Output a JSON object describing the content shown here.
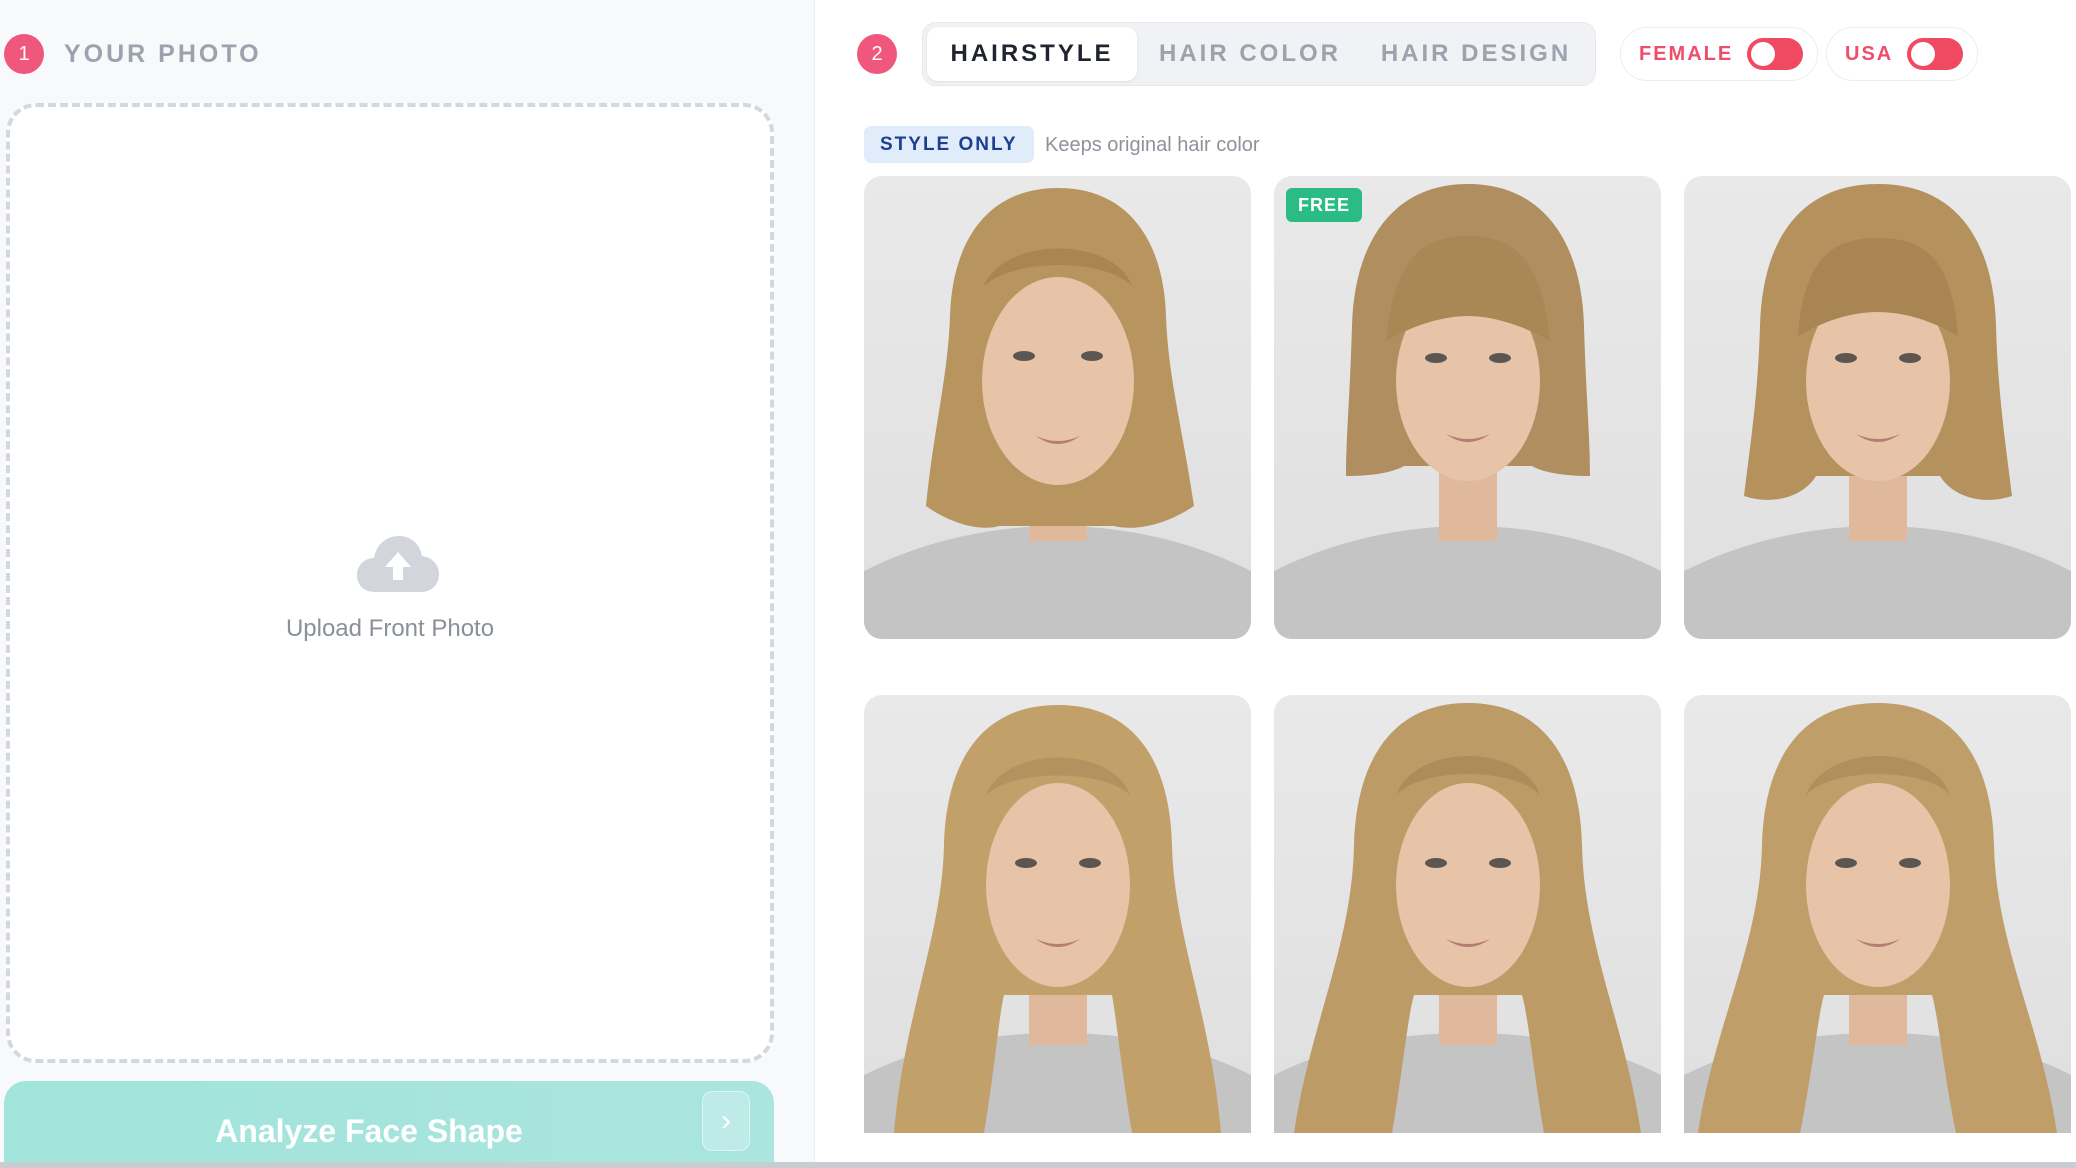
{
  "left": {
    "step": "1",
    "title": "YOUR PHOTO",
    "upload_label": "Upload Front Photo",
    "analyze_label": "Analyze Face Shape",
    "analyze_chevron": "›"
  },
  "right": {
    "step": "2",
    "tabs": [
      {
        "label": "HAIRSTYLE",
        "active": true
      },
      {
        "label": "HAIR COLOR",
        "active": false
      },
      {
        "label": "HAIR DESIGN",
        "active": false
      }
    ],
    "toggles": [
      {
        "label": "FEMALE",
        "on": true
      },
      {
        "label": "USA",
        "on": true
      }
    ],
    "style_badge": "STYLE ONLY",
    "style_note": "Keeps original hair color",
    "styles": [
      {
        "badge": "",
        "hair_length": "medium"
      },
      {
        "badge": "FREE",
        "hair_length": "bob-bangs"
      },
      {
        "badge": "",
        "hair_length": "bob-bangs"
      },
      {
        "badge": "",
        "hair_length": "long"
      },
      {
        "badge": "",
        "hair_length": "long"
      },
      {
        "badge": "",
        "hair_length": "long"
      }
    ]
  },
  "colors": {
    "accent": "#f0577d",
    "toggle_on": "#f04a62",
    "analyze_button": "#a0e4db",
    "free_badge": "#2bbb84",
    "hair": "#b8945f",
    "skin": "#e7c3a8",
    "shirt": "#c4c4c4"
  },
  "icons": {
    "upload": "cloud-upload-icon",
    "analyze": "chevron-right-icon"
  }
}
